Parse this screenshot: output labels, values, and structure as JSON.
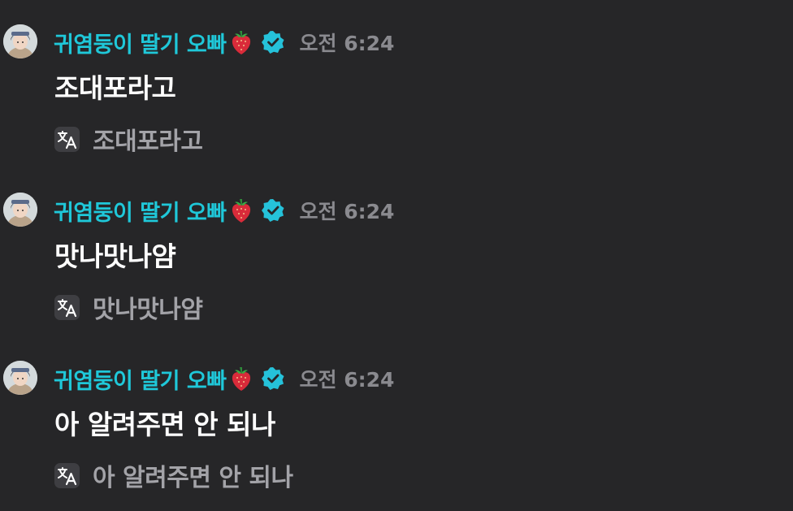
{
  "messages": [
    {
      "username": "귀염둥이 딸기 오빠",
      "timestamp": "오전 6:24",
      "content": "조대포라고",
      "translation": "조대포라고",
      "username_color": "#1fc8d9"
    },
    {
      "username": "귀염둥이 딸기 오빠",
      "timestamp": "오전 6:24",
      "content": "맛나맛나얌",
      "translation": "맛나맛나얌",
      "username_color": "#1fc8d9"
    },
    {
      "username": "귀염둥이 딸기 오빠",
      "timestamp": "오전 6:24",
      "content": "아 알려주면 안 되나",
      "translation": "아 알려주면 안 되나",
      "username_color": "#1fc8d9"
    }
  ],
  "icons": {
    "badge": "strawberry-icon",
    "verified": "verified-icon",
    "translate": "translate-icon"
  },
  "colors": {
    "background": "#262628",
    "accent": "#1fc8d9",
    "timestamp": "#8a8a8f"
  }
}
